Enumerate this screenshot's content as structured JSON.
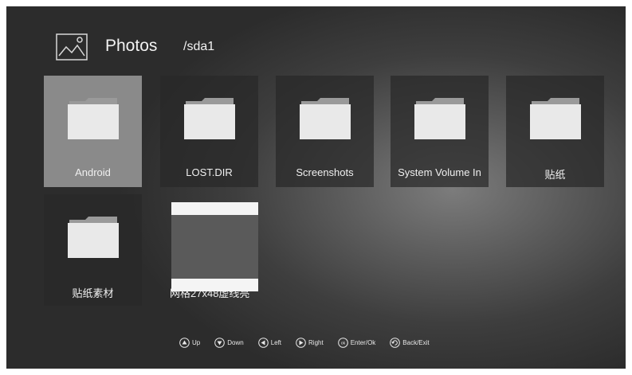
{
  "header": {
    "title": "Photos",
    "path": "/sda1",
    "icon": "photo-icon"
  },
  "tiles": [
    {
      "label": "Android",
      "icon": "folder-icon",
      "selected": true
    },
    {
      "label": "LOST.DIR",
      "icon": "folder-icon"
    },
    {
      "label": "Screenshots",
      "icon": "folder-icon"
    },
    {
      "label": "System Volume In",
      "icon": "folder-icon"
    },
    {
      "label": "贴纸",
      "icon": "folder-icon"
    },
    {
      "label": "贴纸素材",
      "icon": "folder-icon"
    },
    {
      "label": "网格27x48虚线亮",
      "icon": "image-thumbnail"
    }
  ],
  "hints": [
    {
      "label": "Up",
      "icon": "up-button-icon"
    },
    {
      "label": "Down",
      "icon": "down-button-icon"
    },
    {
      "label": "Left",
      "icon": "left-button-icon"
    },
    {
      "label": "Right",
      "icon": "right-button-icon"
    },
    {
      "label": "Enter/Ok",
      "icon": "ok-button-icon"
    },
    {
      "label": "Back/Exit",
      "icon": "back-icon"
    }
  ],
  "colors": {
    "selected": "#8a8a8a",
    "tile": "#282828",
    "text": "#f0f0f0"
  }
}
